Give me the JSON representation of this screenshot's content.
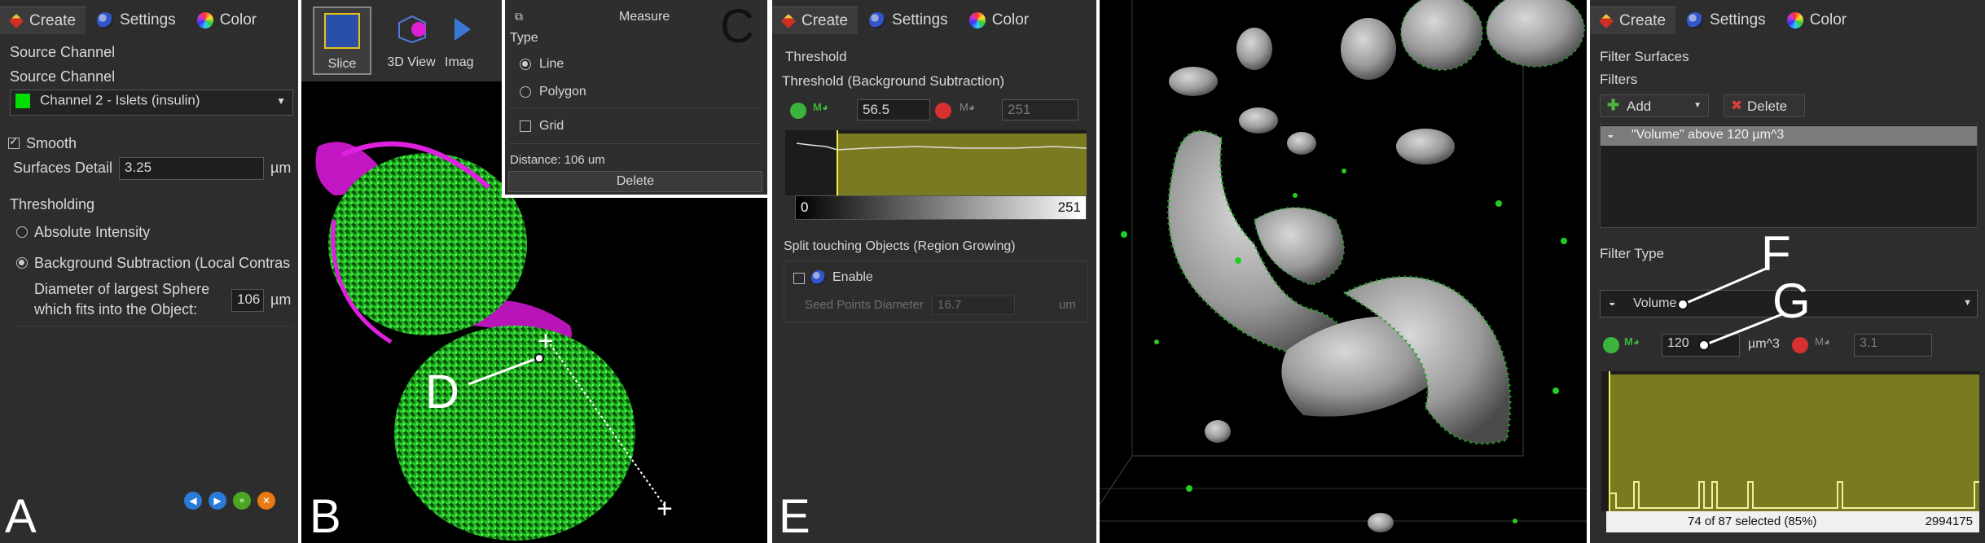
{
  "panel_a": {
    "tabs": [
      "Create",
      "Settings",
      "Color"
    ],
    "source_channel_header": "Source Channel",
    "source_channel_label": "Source Channel",
    "channel_value": "Channel 2 - Islets (insulin)",
    "channel_color": "#00dd00",
    "smooth_label": "Smooth",
    "surfaces_detail_label": "Surfaces Detail",
    "surfaces_detail_value": "3.25",
    "surfaces_detail_unit": "µm",
    "thresholding_header": "Thresholding",
    "absolute_label": "Absolute Intensity",
    "background_label": "Background Subtraction (Local Contras",
    "diameter_label_1": "Diameter of largest Sphere",
    "diameter_label_2": "which fits into the Object:",
    "diameter_value": "106",
    "diameter_unit": "µm",
    "letter": "A"
  },
  "panel_b": {
    "toolbar": [
      "Slice",
      "3D View",
      "Imag"
    ],
    "letter": "B",
    "callout": "D"
  },
  "panel_c": {
    "title": "Measure",
    "type_label": "Type",
    "line_label": "Line",
    "polygon_label": "Polygon",
    "grid_label": "Grid",
    "distance": "Distance: 106 um",
    "delete_label": "Delete",
    "letter": "C"
  },
  "panel_e": {
    "tabs": [
      "Create",
      "Settings",
      "Color"
    ],
    "threshold_header": "Threshold",
    "threshold_sub": "Threshold (Background Subtraction)",
    "low_value": "56.5",
    "high_value": "251",
    "hist_min": "0",
    "hist_max": "251",
    "split_header": "Split touching Objects (Region Growing)",
    "enable_label": "Enable",
    "seed_label": "Seed Points Diameter",
    "seed_value": "16.7",
    "seed_unit": "um",
    "letter": "E"
  },
  "panel_f": {
    "tabs": [
      "Create",
      "Settings",
      "Color"
    ],
    "filter_surfaces": "Filter Surfaces",
    "filters_label": "Filters",
    "add_label": "Add",
    "delete_label": "Delete",
    "filter_item": "\"Volume\" above 120 µm^3",
    "filter_type_label": "Filter Type",
    "filter_type_value": "Volume",
    "low_value": "120",
    "unit": "µm^3",
    "high_value": "3.1",
    "selection_status": "74 of 87 selected (85%)",
    "max_value": "2994175",
    "letter_f": "F",
    "letter_g": "G"
  },
  "colors": {
    "panel_bg": "#2d2d2d",
    "histogram_fill": "#7a7a20",
    "magenta": "#e020e0",
    "green": "#22cc22"
  }
}
